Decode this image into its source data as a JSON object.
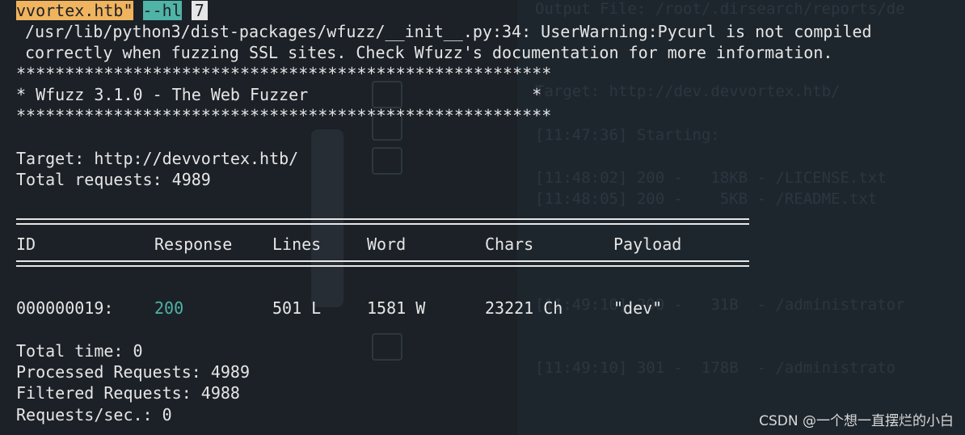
{
  "background": {
    "lines": [
      "Output File: /root/.dirsearch/reports/de",
      "Target: http://dev.devvortex.htb/",
      "[11:47:36] Starting:",
      "[11:48:02] 200 -   18KB - /LICENSE.txt",
      "[11:48:05] 200 -    5KB - /README.txt",
      "[11:49:10] 200 -   31B  - /administrator",
      "[11:49:10] 301 -  178B  - /administrato"
    ]
  },
  "command": {
    "host_fragment": "vvortex.htb\"",
    "flag": "--hl",
    "flag_value": "7"
  },
  "warning": {
    "line1": "/usr/lib/python3/dist-packages/wfuzz/__init__.py:34: UserWarning:Pycurl is not compiled",
    "line2": "correctly when fuzzing SSL sites. Check Wfuzz's documentation for more information."
  },
  "banner": {
    "stars": "*******************************************************",
    "title_line": "* Wfuzz 3.1.0 - The Web Fuzzer                       *"
  },
  "target": {
    "target_line": "Target: http://devvortex.htb/",
    "total_line": "Total requests: 4989"
  },
  "table": {
    "headers": [
      "ID",
      "Response",
      "Lines",
      "Word",
      "Chars",
      "Payload"
    ],
    "row": {
      "id": "000000019:",
      "response": "200",
      "lines": "501 L",
      "word": "1581 W",
      "chars": "23221 Ch",
      "payload": "\"dev\""
    }
  },
  "summary": {
    "total_time": "Total time: 0",
    "processed": "Processed Requests: 4989",
    "filtered": "Filtered Requests: 4988",
    "rate": "Requests/sec.: 0"
  },
  "watermark": "CSDN @一个想一直摆烂的小白",
  "colors": {
    "background": "#1c2127",
    "text": "#e6e6e6",
    "accent_teal": "#4fb3a7",
    "accent_orange": "#f0b35e"
  }
}
